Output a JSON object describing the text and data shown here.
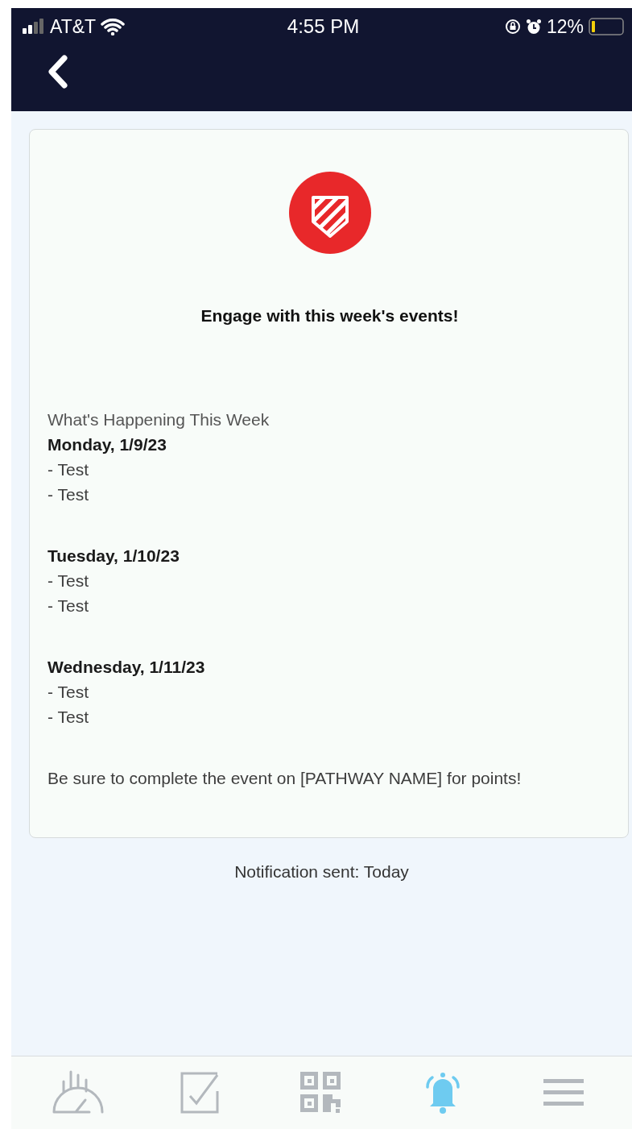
{
  "status_bar": {
    "carrier": "AT&T",
    "time": "4:55 PM",
    "battery": "12%"
  },
  "card": {
    "title": "Engage with this week's events!",
    "intro": "What's Happening This Week",
    "days": [
      {
        "heading": "Monday, 1/9/23",
        "items": [
          "- Test",
          "- Test"
        ]
      },
      {
        "heading": "Tuesday, 1/10/23",
        "items": [
          "- Test",
          "- Test"
        ]
      },
      {
        "heading": "Wednesday, 1/11/23",
        "items": [
          "- Test",
          "- Test"
        ]
      }
    ],
    "footer": "Be sure to complete the event on [PATHWAY NAME] for points!"
  },
  "notification_sent": "Notification sent: Today",
  "tab_bar": [
    {
      "kind": "gauge",
      "selected": false
    },
    {
      "kind": "checkbox",
      "selected": false
    },
    {
      "kind": "qr",
      "selected": false
    },
    {
      "kind": "bell",
      "selected": true
    },
    {
      "kind": "menu",
      "selected": false
    }
  ]
}
